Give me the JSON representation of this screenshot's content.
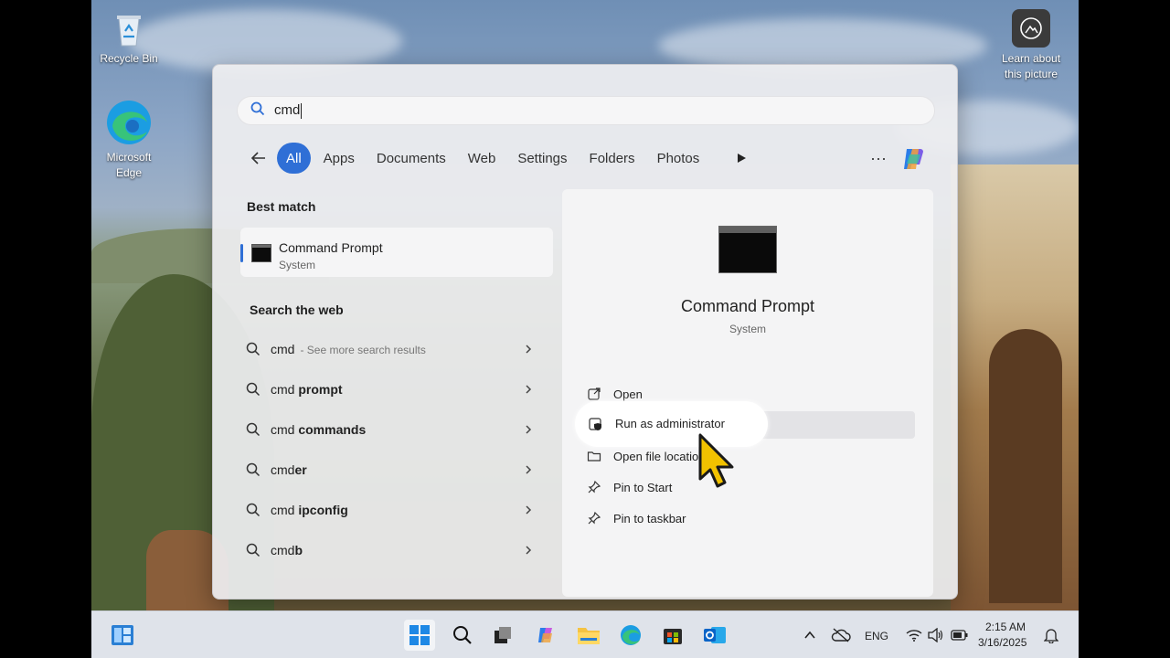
{
  "desktop": {
    "icons": {
      "recycle_bin": "Recycle Bin",
      "edge_line1": "Microsoft",
      "edge_line2": "Edge",
      "learn_line1": "Learn about",
      "learn_line2": "this picture"
    }
  },
  "search": {
    "query": "cmd",
    "filters": [
      "All",
      "Apps",
      "Documents",
      "Web",
      "Settings",
      "Folders",
      "Photos"
    ],
    "active_filter": "All",
    "more_label": "···"
  },
  "best_match": {
    "heading": "Best match",
    "title": "Command Prompt",
    "subtitle": "System"
  },
  "web": {
    "heading": "Search the web",
    "items": [
      {
        "prefix": "cmd",
        "bold": "",
        "hint": "- See more search results"
      },
      {
        "prefix": "cmd ",
        "bold": "prompt",
        "hint": ""
      },
      {
        "prefix": "cmd ",
        "bold": "commands",
        "hint": ""
      },
      {
        "prefix": "cmd",
        "bold": "er",
        "hint": ""
      },
      {
        "prefix": "cmd ",
        "bold": "ipconfig",
        "hint": ""
      },
      {
        "prefix": "cmd",
        "bold": "b",
        "hint": ""
      }
    ]
  },
  "preview": {
    "app_name": "Command Prompt",
    "app_type": "System",
    "actions": {
      "open": "Open",
      "run_as_admin": "Run as administrator",
      "open_file_location": "Open file location",
      "pin_to_start": "Pin to Start",
      "pin_to_taskbar": "Pin to taskbar"
    }
  },
  "taskbar": {
    "language": "ENG",
    "time": "2:15 AM",
    "date": "3/16/2025"
  },
  "colors": {
    "accent": "#2f6fd6",
    "cursor": "#f2c200"
  }
}
